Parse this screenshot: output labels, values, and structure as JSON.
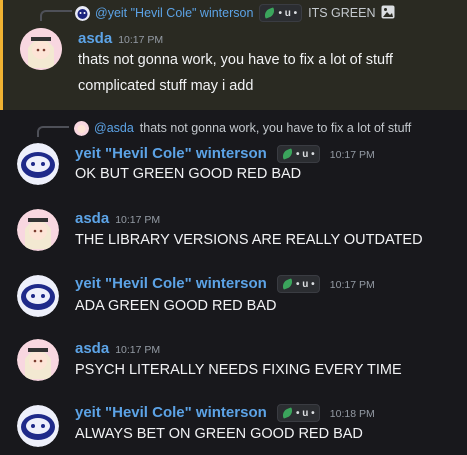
{
  "messages": [
    {
      "reply": {
        "name": "@yeit \"Hevil Cole\" winterson",
        "tag": "• u •",
        "text": "ITS GREEN"
      },
      "author": "asda",
      "time": "10:17 PM",
      "lines": [
        "thats not gonna work, you have to fix a lot of stuff",
        "complicated stuff may i add"
      ]
    },
    {
      "reply": {
        "name": "@asda",
        "text": "thats not gonna work, you have to fix a lot of stuff"
      },
      "author": "yeit \"Hevil Cole\" winterson",
      "tag": "• u •",
      "time": "10:17 PM",
      "lines": [
        "OK BUT GREEN GOOD RED BAD"
      ]
    },
    {
      "author": "asda",
      "time": "10:17 PM",
      "lines": [
        "THE LIBRARY VERSIONS ARE REALLY OUTDATED"
      ]
    },
    {
      "author": "yeit \"Hevil Cole\" winterson",
      "tag": "• u •",
      "time": "10:17 PM",
      "lines": [
        "ADA GREEN GOOD RED BAD"
      ]
    },
    {
      "author": "asda",
      "time": "10:17 PM",
      "lines": [
        "PSYCH LITERALLY NEEDS FIXING EVERY TIME"
      ]
    },
    {
      "author": "yeit \"Hevil Cole\" winterson",
      "tag": "• u •",
      "time": "10:18 PM",
      "lines": [
        "ALWAYS BET ON GREEN GOOD RED BAD"
      ]
    }
  ],
  "colors": {
    "name": "#5ca3e6",
    "highlight_bar": "#f0b232",
    "tag_leaf": "#3ba55c"
  },
  "icons": {
    "image_attachment": "image-icon",
    "tag": "leaf-icon"
  }
}
